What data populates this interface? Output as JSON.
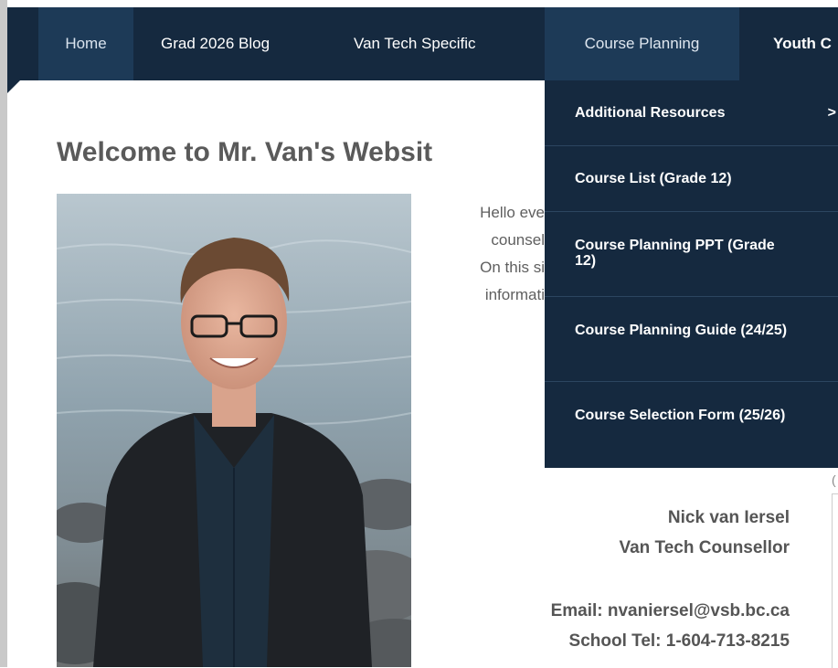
{
  "nav": {
    "items": [
      "Home",
      "Grad 2026 Blog",
      "Van Tech Specific",
      "Course Planning",
      "Youth C"
    ]
  },
  "dropdown": {
    "items": [
      "Additional Resources",
      "Course List (Grade 12)",
      "Course Planning PPT (Grade 12)",
      "Course Planning Guide (24/25)",
      "Course Selection Form (25/26)"
    ],
    "submenu_arrow": ">"
  },
  "page": {
    "title": "Welcome to Mr. Van's Websit",
    "intro_lines": [
      "Hello eve",
      "counsel",
      "On this si",
      "informati"
    ]
  },
  "contact": {
    "name": "Nick van Iersel",
    "role": "Van Tech Counsellor",
    "email": "Email: nvaniersel@vsb.bc.ca",
    "phone": "School Tel: 1-604-713-8215"
  },
  "colors": {
    "nav_bg": "#15293f",
    "nav_active_bg": "#1d3a57",
    "title_text": "#5a5a5a"
  }
}
